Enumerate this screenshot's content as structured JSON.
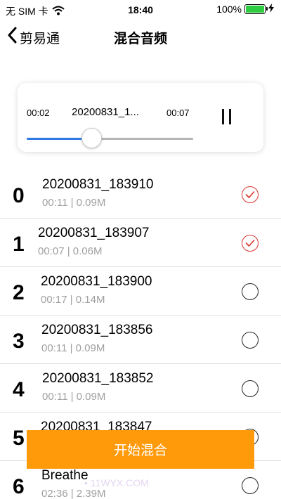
{
  "status_bar": {
    "carrier": "无 SIM 卡",
    "time": "18:40",
    "battery_percent": "100%",
    "battery_level": 1.0,
    "battery_color": "#2ecc40"
  },
  "nav": {
    "back_label": "剪易通",
    "title": "混合音频"
  },
  "player": {
    "current_time": "00:02",
    "file_name": "20200831_1...",
    "total_time": "00:07",
    "progress": 0.39,
    "progress_color": "#2f7be6"
  },
  "tracks": [
    {
      "index": "0",
      "name": "20200831_183910",
      "meta": "00:11 | 0.09M",
      "selected": true
    },
    {
      "index": "1",
      "name": "20200831_183907",
      "meta": "00:07 | 0.06M",
      "selected": true
    },
    {
      "index": "2",
      "name": "20200831_183900",
      "meta": "00:17 | 0.14M",
      "selected": false
    },
    {
      "index": "3",
      "name": "20200831_183856",
      "meta": "00:11 | 0.09M",
      "selected": false
    },
    {
      "index": "4",
      "name": "20200831_183852",
      "meta": "00:11 | 0.09M",
      "selected": false
    },
    {
      "index": "5",
      "name": "20200831_183847",
      "meta": "",
      "selected": false
    },
    {
      "index": "6",
      "name": "Breathe",
      "meta": "02:36 | 2.39M",
      "selected": false
    }
  ],
  "mix_button_label": "开始混合",
  "accent_color": "#ff9a0b",
  "check_color": "#d9342b",
  "watermark": "• 11WYX.COM"
}
